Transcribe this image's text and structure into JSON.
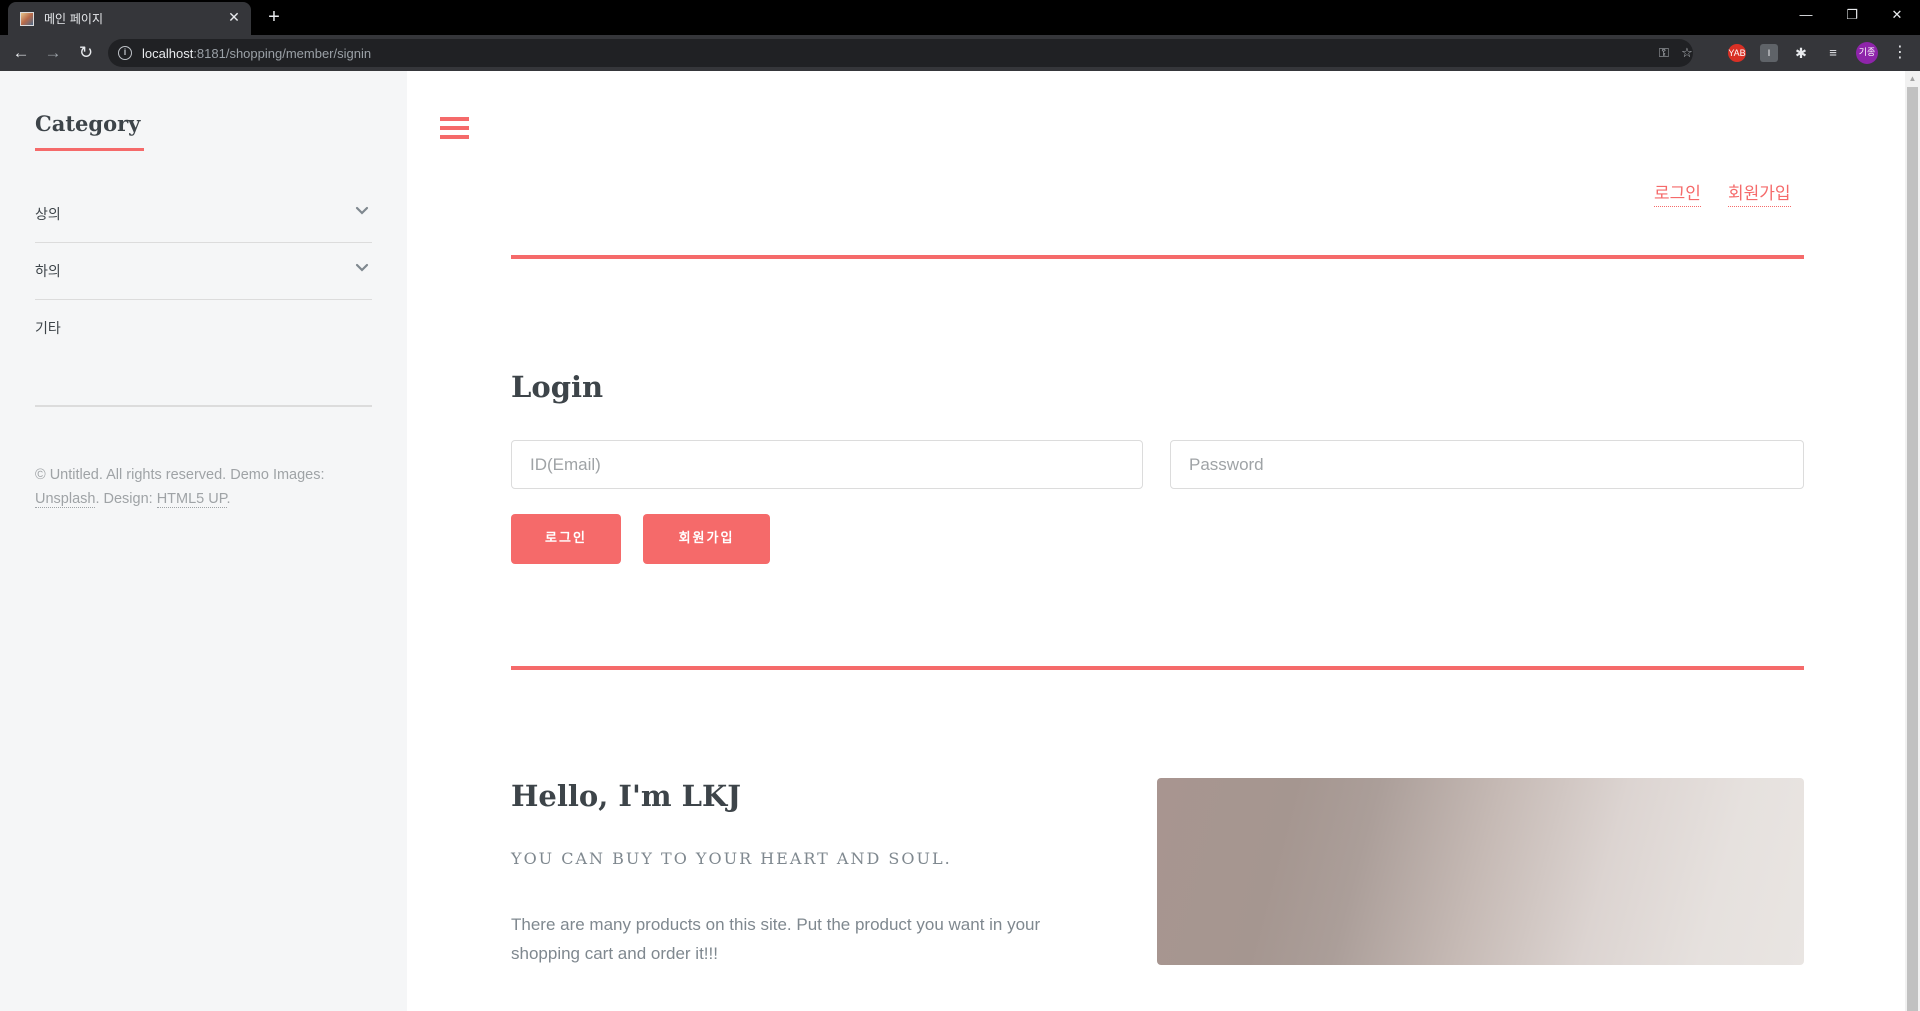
{
  "browser": {
    "tab_title": "메인 페이지",
    "url_host": "localhost",
    "url_rest": ":8181/shopping/member/signin",
    "avatar_text": "기종",
    "ext_yab_label": "YAB",
    "ext_box_label": "I"
  },
  "sidebar": {
    "heading": "Category",
    "items": [
      {
        "label": "상의",
        "icon": "chevron-down-icon"
      },
      {
        "label": "하의",
        "icon": "chevron-down-icon"
      },
      {
        "label": "기타"
      }
    ],
    "copyright_prefix": "© Untitled. All rights reserved. Demo Images: ",
    "unsplash_link": "Unsplash",
    "design_prefix": ". Design: ",
    "html5up_link": "HTML5 UP",
    "copyright_suffix": "."
  },
  "header": {
    "login_link": "로그인",
    "signup_link": "회원가입"
  },
  "login": {
    "title": "Login",
    "email_placeholder": "ID(Email)",
    "password_placeholder": "Password",
    "login_button": "로그인",
    "signup_button": "회원가입"
  },
  "intro": {
    "heading": "Hello, I'm LKJ",
    "tagline": "YOU CAN BUY TO YOUR HEART AND SOUL.",
    "description": "There are many products on this site. Put the product you want in your shopping cart and order it!!!"
  },
  "colors": {
    "accent": "#f56a6a",
    "text": "#3d4449",
    "muted": "#7f888f",
    "sidebar_bg": "#f5f6f7"
  }
}
